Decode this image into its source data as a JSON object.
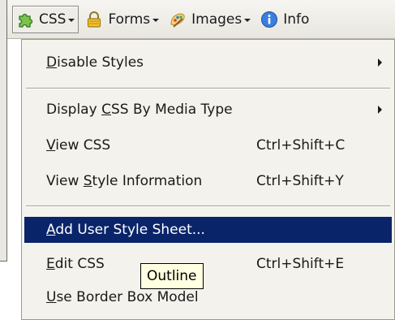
{
  "toolbar": {
    "buttons": [
      {
        "label": "CSS",
        "icon": "css-puzzle-icon"
      },
      {
        "label": "Forms",
        "icon": "forms-lock-icon"
      },
      {
        "label": "Images",
        "icon": "images-brush-icon"
      },
      {
        "label": "Info",
        "icon": "info-icon"
      }
    ]
  },
  "menu": {
    "items": [
      {
        "pre": "",
        "mnemonic": "D",
        "post": "isable Styles",
        "shortcut": "",
        "submenu": true,
        "highlighted": false
      },
      {
        "pre": "Display ",
        "mnemonic": "C",
        "post": "SS By Media Type",
        "shortcut": "",
        "submenu": true,
        "highlighted": false
      },
      {
        "pre": "",
        "mnemonic": "V",
        "post": "iew CSS",
        "shortcut": "Ctrl+Shift+C",
        "submenu": false,
        "highlighted": false
      },
      {
        "pre": "View ",
        "mnemonic": "S",
        "post": "tyle Information",
        "shortcut": "Ctrl+Shift+Y",
        "submenu": false,
        "highlighted": false
      },
      {
        "pre": "",
        "mnemonic": "A",
        "post": "dd User Style Sheet...",
        "shortcut": "",
        "submenu": false,
        "highlighted": true
      },
      {
        "pre": "",
        "mnemonic": "E",
        "post": "dit CSS",
        "shortcut": "Ctrl+Shift+E",
        "submenu": false,
        "highlighted": false
      },
      {
        "pre": "",
        "mnemonic": "U",
        "post": "se Border Box Model",
        "shortcut": "",
        "submenu": false,
        "highlighted": false
      }
    ]
  },
  "tooltip": {
    "text": "Outline"
  },
  "colors": {
    "highlight": "#0a246a",
    "menu_bg": "#f3f2ec",
    "tooltip_bg": "#ffffe1"
  }
}
